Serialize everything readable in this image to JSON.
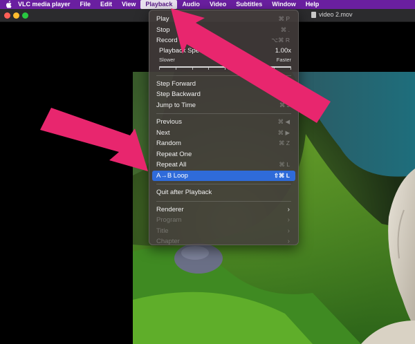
{
  "menubar": {
    "app": "VLC media player",
    "items": [
      "File",
      "Edit",
      "View",
      "Playback",
      "Audio",
      "Video",
      "Subtitles",
      "Window",
      "Help"
    ],
    "active": "Playback"
  },
  "window": {
    "title": "video 2.mov"
  },
  "menu": {
    "play": {
      "label": "Play",
      "shortcut": "⌘ P"
    },
    "stop": {
      "label": "Stop",
      "shortcut": "⌘ ."
    },
    "record": {
      "label": "Record",
      "shortcut": "⌥⌘ R"
    },
    "speed": {
      "label": "Playback Speed",
      "value": "1.00x",
      "slower": "Slower",
      "normal": "Normal",
      "faster": "Faster",
      "level": 0.5
    },
    "step_forward": {
      "label": "Step Forward",
      "shortcut": ""
    },
    "step_backward": {
      "label": "Step Backward",
      "shortcut": ""
    },
    "jump": {
      "label": "Jump to Time",
      "shortcut": "⌘ J"
    },
    "previous": {
      "label": "Previous",
      "shortcut": "⌘ ◀"
    },
    "next": {
      "label": "Next",
      "shortcut": "⌘ ▶"
    },
    "random": {
      "label": "Random",
      "shortcut": "⌘ Z"
    },
    "repeat_one": {
      "label": "Repeat One",
      "shortcut": ""
    },
    "repeat_all": {
      "label": "Repeat All",
      "shortcut": "⌘ L"
    },
    "ab_loop": {
      "label": "A→B Loop",
      "shortcut": "⇧⌘ L"
    },
    "quit_after": {
      "label": "Quit after Playback",
      "shortcut": ""
    },
    "renderer": {
      "label": "Renderer"
    },
    "program": {
      "label": "Program"
    },
    "title": {
      "label": "Title"
    },
    "chapter": {
      "label": "Chapter"
    }
  },
  "colors": {
    "menubar": "#6a1fa0",
    "highlight": "#2f6bd9",
    "annotation_arrow": "#e8266e"
  },
  "icons": {
    "apple": "apple-logo-icon",
    "submenu": "chevron-right-icon",
    "doc": "document-icon"
  }
}
